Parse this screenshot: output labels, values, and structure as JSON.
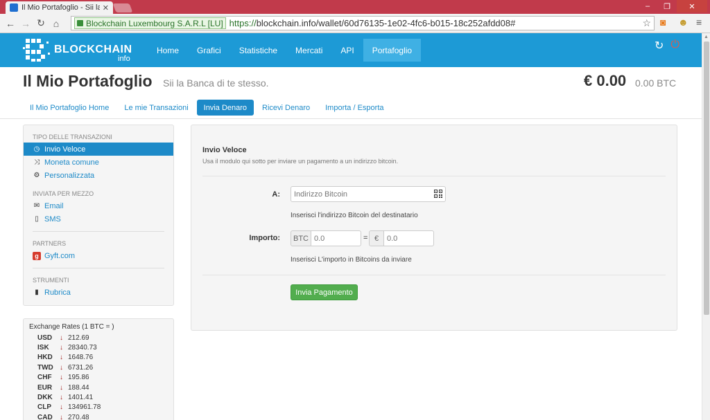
{
  "browser": {
    "tab_title": "Il Mio Portafoglio - Sii la B",
    "ev_label": "Blockchain Luxembourg S.A.R.L [LU]",
    "url_https": "https://",
    "url_rest": "blockchain.info/wallet/60d76135-1e02-4fc6-b015-18c252afdd08#"
  },
  "brand": {
    "name": "BLOCKCHAIN",
    "sub": "info"
  },
  "nav": {
    "items": [
      "Home",
      "Grafici",
      "Statistiche",
      "Mercati",
      "API",
      "Portafoglio"
    ],
    "active": "Portafoglio"
  },
  "header": {
    "title": "Il Mio Portafoglio",
    "subtitle": "Sii la Banca di te stesso.",
    "balance": "€ 0.00",
    "balance_btc": "0.00 BTC"
  },
  "subnav": {
    "items": [
      "Il Mio Portafoglio Home",
      "Le mie Transazioni",
      "Invia Denaro",
      "Ricevi Denaro",
      "Importa / Esporta"
    ],
    "active": "Invia Denaro"
  },
  "sidebar": {
    "sections": [
      {
        "heading": "TIPO DELLE TRANSAZIONI",
        "items": [
          "Invio Veloce",
          "Moneta comune",
          "Personalizzata"
        ]
      },
      {
        "heading": "INVIATA PER MEZZO",
        "items": [
          "Email",
          "SMS"
        ]
      },
      {
        "heading": "PARTNERS",
        "items": [
          "Gyft.com"
        ]
      },
      {
        "heading": "STRUMENTI",
        "items": [
          "Rubrica"
        ]
      }
    ]
  },
  "rates": {
    "title": "Exchange Rates (1 BTC = )",
    "rows": [
      {
        "cur": "USD",
        "val": "212.69"
      },
      {
        "cur": "ISK",
        "val": "28340.73"
      },
      {
        "cur": "HKD",
        "val": "1648.76"
      },
      {
        "cur": "TWD",
        "val": "6731.26"
      },
      {
        "cur": "CHF",
        "val": "195.86"
      },
      {
        "cur": "EUR",
        "val": "188.44"
      },
      {
        "cur": "DKK",
        "val": "1401.41"
      },
      {
        "cur": "CLP",
        "val": "134961.78"
      },
      {
        "cur": "CAD",
        "val": "270.48"
      }
    ]
  },
  "form": {
    "title": "Invio Veloce",
    "description": "Usa il modulo qui sotto per inviare un pagamento a un indirizzo bitcoin.",
    "to_label": "A:",
    "address_placeholder": "Indirizzo Bitcoin",
    "address_help": "Inserisci l'indirizzo Bitcoin del destinatario",
    "amount_label": "Importo:",
    "btc_addon": "BTC",
    "btc_placeholder": "0.0",
    "equals": "=",
    "eur_addon": "€",
    "eur_placeholder": "0.0",
    "amount_help": "Inserisci L'importo in Bitcoins da inviare",
    "submit_label": "Invia Pagamento"
  }
}
